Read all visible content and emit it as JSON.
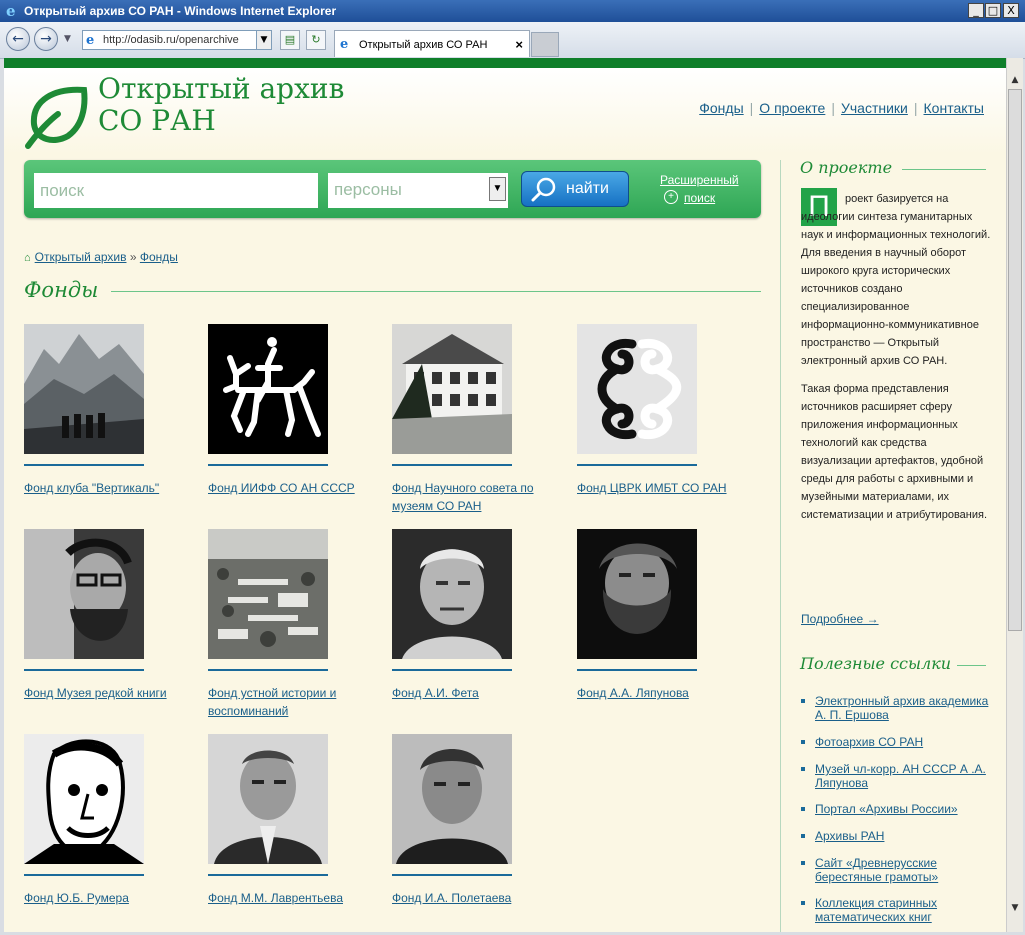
{
  "window": {
    "title": "Открытый архив СО РАН - Windows Internet Explorer",
    "min": "_",
    "max": "□",
    "close": "X"
  },
  "browser": {
    "url": "http://odasib.ru/openarchive",
    "tab_title": "Открытый архив СО РАН",
    "tab_close": "×"
  },
  "site": {
    "logo_line1": "Открытый архив",
    "logo_line2": "СО РАН",
    "nav": [
      "Фонды",
      "О проекте",
      "Участники",
      "Контакты"
    ],
    "nav_sep": "|"
  },
  "search": {
    "placeholder": "поиск",
    "scope": "персоны",
    "button": "найти",
    "adv_line1": "Расширенный",
    "adv_line2": "поиск"
  },
  "breadcrumb": {
    "home": "Открытый архив",
    "sep": "»",
    "current": "Фонды"
  },
  "page_title": "Фонды",
  "funds": [
    {
      "caption": "Фонд клуба \"Вертикаль\""
    },
    {
      "caption": "Фонд ИИФФ СО АН СССР"
    },
    {
      "caption": "Фонд Научного совета по музеям СО РАН"
    },
    {
      "caption": "Фонд ЦВРК ИМБТ СО РАН"
    },
    {
      "caption": "Фонд Музея редкой книги"
    },
    {
      "caption": "Фонд устной истории и воспоминаний"
    },
    {
      "caption": "Фонд А.И. Фета"
    },
    {
      "caption": "Фонд А.А. Ляпунова"
    },
    {
      "caption": "Фонд Ю.Б. Румера"
    },
    {
      "caption": "Фонд М.М. Лаврентьева"
    },
    {
      "caption": "Фонд И.А. Полетаева"
    }
  ],
  "sidebar": {
    "about_title": "О проекте",
    "about_dropcap": "П",
    "about_p1": "роект базируется на идеологии синтеза гуманитарных наук и информационных технологий. Для введения в научный оборот широкого круга исторических источников создано специализированное информационно-коммуникативное пространство — Открытый электронный архив СО РАН.",
    "about_p2": "Такая форма представления источников расширяет сферу приложения информационных технологий как средства визуализации артефактов, удобной среды для работы с архивными и музейными материалами, их систематизации и атрибутирования.",
    "more": "Подробнее →",
    "links_title": "Полезные ссылки",
    "links": [
      "Электронный архив академика А. П. Ершова",
      "Фотоархив СО РАН",
      "Музей чл-корр. АН СССР А .А. Ляпунова",
      "Портал «Архивы России»",
      "Архивы РАН",
      "Сайт «Древнерусские берестяные грамоты»",
      "Коллекция старинных математических книг"
    ]
  }
}
